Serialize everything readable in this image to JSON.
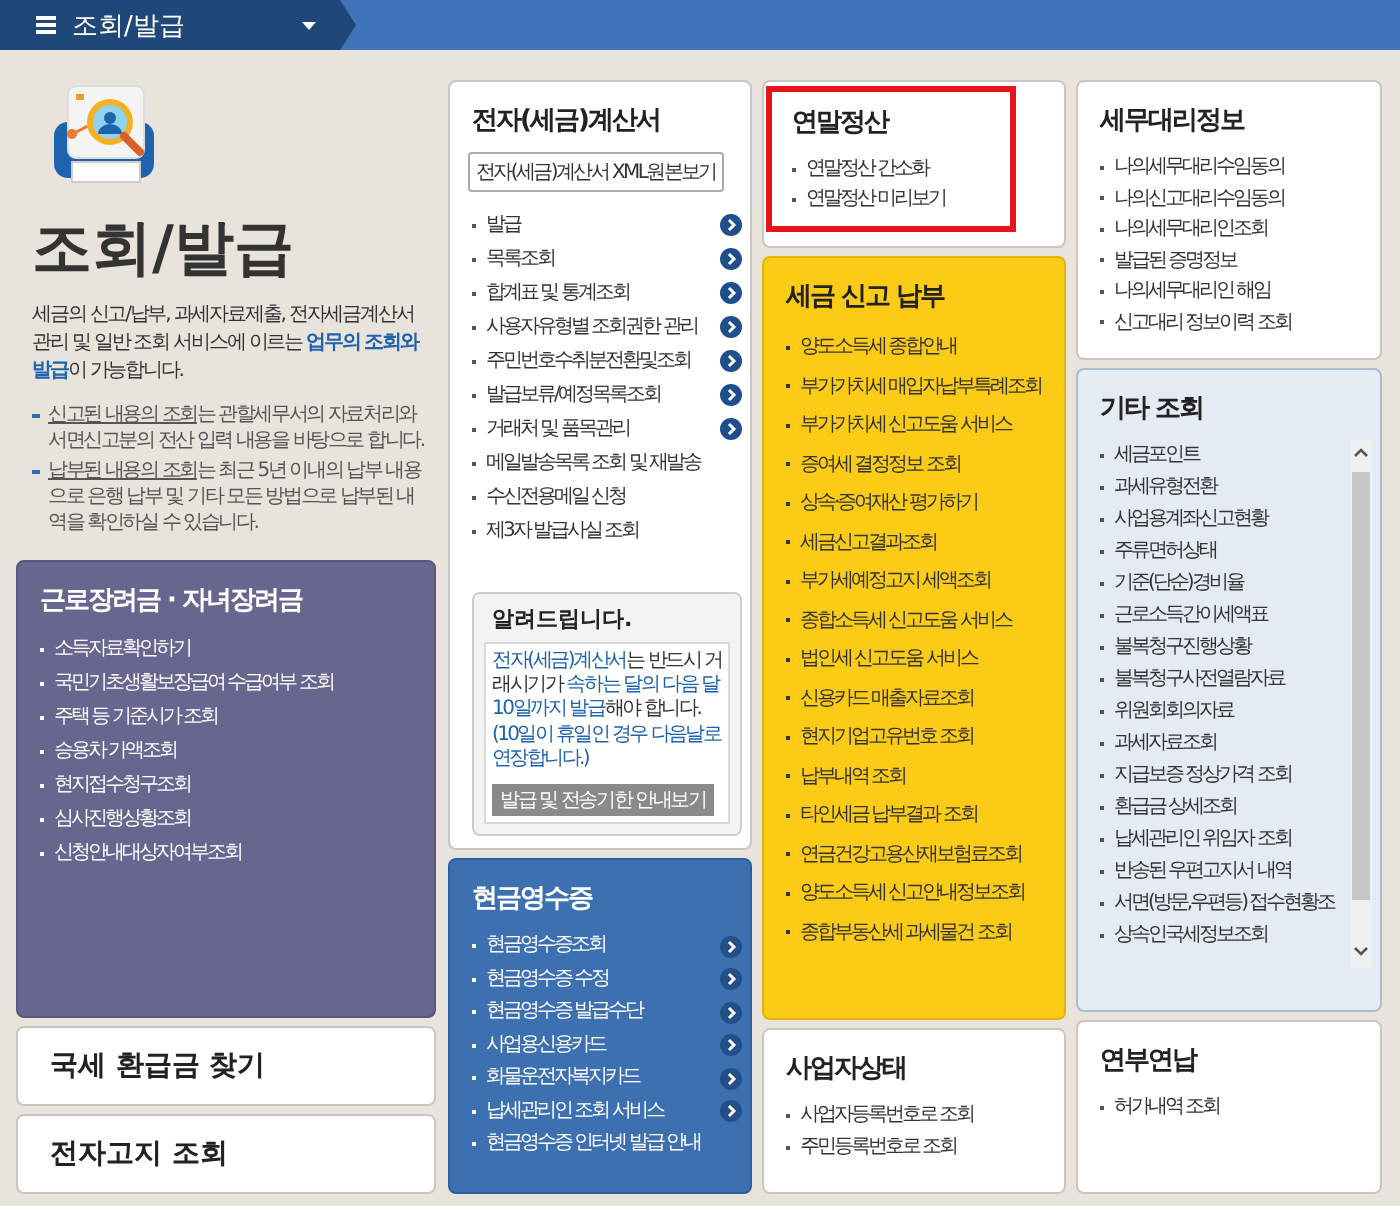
{
  "topbar": {
    "title": "조회/발급"
  },
  "intro": {
    "title": "조회/발급",
    "description": "세금의 신고/납부, 과세자료제출, 전자세금계산서 관리 및 일반 조회 서비스에 이르는 **업무의 조회와 발급**이 가능합니다.",
    "notes": [
      "**신고된 내용의 조회**는 관할세무서의 자료처리와 서면신고분의 전산 입력 내용을 바탕으로 합니다.",
      "**납부된 내용의 조회**는 최근 5년 이내의 납부 내용으로 은행 납부 및 기타 모든 방법으로 납부된 내역을 확인하실 수 있습니다."
    ]
  },
  "columns": [
    {
      "cards": [
        {
          "kind": "purple",
          "highlighted": false,
          "title": "근로장려금 · 자녀장려금",
          "items": [
            {
              "label": "소득자료확인하기",
              "arrow": false
            },
            {
              "label": "국민기초생활보장급여 수급여부 조회",
              "arrow": false
            },
            {
              "label": "주택 등 기준시가 조회",
              "arrow": false
            },
            {
              "label": "승용차 가액조회",
              "arrow": false
            },
            {
              "label": "현지접수청구조회",
              "arrow": false
            },
            {
              "label": "심사진행상황조회",
              "arrow": false
            },
            {
              "label": "신청안내대상자여부조회",
              "arrow": false
            }
          ]
        },
        {
          "kind": "link",
          "highlighted": false,
          "title": "국세 환급금 찾기"
        },
        {
          "kind": "link",
          "highlighted": false,
          "title": "전자고지 조회"
        }
      ]
    },
    {
      "cards": [
        {
          "kind": "white",
          "highlighted": false,
          "title": "전자(세금)계산서",
          "button": "전자(세금)계산서 XML원본보기",
          "items": [
            {
              "label": "발급",
              "arrow": true
            },
            {
              "label": "목록조회",
              "arrow": true
            },
            {
              "label": "합계표 및 통계조회",
              "arrow": true
            },
            {
              "label": "사용자유형별 조회권한 관리",
              "arrow": true
            },
            {
              "label": "주민번호수취분전환및조회",
              "arrow": true
            },
            {
              "label": "발급보류/예정목록조회",
              "arrow": true
            },
            {
              "label": "거래처 및 품목관리",
              "arrow": true
            },
            {
              "label": "메일발송목록 조회 및 재발송",
              "arrow": false
            },
            {
              "label": "수신전용메일 신청",
              "arrow": false
            },
            {
              "label": "제3자 발급사실 조회",
              "arrow": false
            }
          ],
          "notice": {
            "title": "알려드립니다.",
            "text": "**전자(세금)계산서**는 반드시 거래시기가 **속하는 달의 다음 달 10일까지 발급**해야 합니다.",
            "footnote": "(10일이 휴일인 경우 다음날로 연장합니다.)",
            "button": "발급 및 전송기한 안내보기"
          }
        },
        {
          "kind": "blue",
          "highlighted": false,
          "title": "현금영수증",
          "items": [
            {
              "label": "현금영수증조회",
              "arrow": true
            },
            {
              "label": "현금영수증 수정",
              "arrow": true
            },
            {
              "label": "현금영수증 발급수단",
              "arrow": true
            },
            {
              "label": "사업용신용카드",
              "arrow": true
            },
            {
              "label": "화물운전자복지카드",
              "arrow": true
            },
            {
              "label": "납세관리인 조회 서비스",
              "arrow": true
            },
            {
              "label": "현금영수증 인터넷 발급 안내",
              "arrow": false
            }
          ]
        }
      ]
    },
    {
      "cards": [
        {
          "kind": "white",
          "highlighted": true,
          "title": "연말정산",
          "items": [
            {
              "label": "연말정산 간소화",
              "arrow": false
            },
            {
              "label": "연말정산 미리보기",
              "arrow": false
            }
          ]
        },
        {
          "kind": "yellow",
          "highlighted": false,
          "title": "세금 신고 납부",
          "items": [
            {
              "label": "양도소득세 종합안내",
              "arrow": false
            },
            {
              "label": "부가가치세 매입자납부특례조회",
              "arrow": false
            },
            {
              "label": "부가가치세 신고도움 서비스",
              "arrow": false
            },
            {
              "label": "증여세 결정정보 조회",
              "arrow": false
            },
            {
              "label": "상속·증여재산 평가하기",
              "arrow": false
            },
            {
              "label": "세금신고결과조회",
              "arrow": false
            },
            {
              "label": "부가세예정고지 세액조회",
              "arrow": false
            },
            {
              "label": "종합소득세 신고도움 서비스",
              "arrow": false
            },
            {
              "label": "법인세 신고도움 서비스",
              "arrow": false
            },
            {
              "label": "신용카드 매출자료조회",
              "arrow": false
            },
            {
              "label": "현지기업고유번호 조회",
              "arrow": false
            },
            {
              "label": "납부내역 조회",
              "arrow": false
            },
            {
              "label": "타인세금 납부결과 조회",
              "arrow": false
            },
            {
              "label": "연금건강고용산재보험료조회",
              "arrow": false
            },
            {
              "label": "양도소득세 신고안내정보조회",
              "arrow": false
            },
            {
              "label": "종합부동산세 과세물건 조회",
              "arrow": false
            }
          ]
        },
        {
          "kind": "white",
          "highlighted": false,
          "title": "사업자상태",
          "items": [
            {
              "label": "사업자등록번호로 조회",
              "arrow": false
            },
            {
              "label": "주민등록번호로 조회",
              "arrow": false
            }
          ]
        }
      ]
    },
    {
      "cards": [
        {
          "kind": "white",
          "highlighted": false,
          "title": "세무대리정보",
          "items": [
            {
              "label": "나의세무대리수임동의",
              "arrow": false
            },
            {
              "label": "나의신고대리수임동의",
              "arrow": false
            },
            {
              "label": "나의세무대리인조회",
              "arrow": false
            },
            {
              "label": "발급된 증명정보",
              "arrow": false
            },
            {
              "label": "나의세무대리인 해임",
              "arrow": false
            },
            {
              "label": "신고대리 정보이력 조회",
              "arrow": false
            }
          ]
        },
        {
          "kind": "pale",
          "highlighted": false,
          "scrollable": true,
          "title": "기타 조회",
          "items": [
            {
              "label": "세금포인트",
              "arrow": false
            },
            {
              "label": "과세유형전환",
              "arrow": false
            },
            {
              "label": "사업용계좌신고현황",
              "arrow": false
            },
            {
              "label": "주류면허상태",
              "arrow": false
            },
            {
              "label": "기준(단순)경비율",
              "arrow": false
            },
            {
              "label": "근로소득간이세액표",
              "arrow": false
            },
            {
              "label": "불복청구진행상황",
              "arrow": false
            },
            {
              "label": "불복청구사전열람자료",
              "arrow": false
            },
            {
              "label": "위원회회의자료",
              "arrow": false
            },
            {
              "label": "과세자료조회",
              "arrow": false
            },
            {
              "label": "지급보증 정상가격 조회",
              "arrow": false
            },
            {
              "label": "환급금 상세조회",
              "arrow": false
            },
            {
              "label": "납세관리인 위임자 조회",
              "arrow": false
            },
            {
              "label": "반송된 우편고지서 내역",
              "arrow": false
            },
            {
              "label": "서면(방문,우편등) 접수현황조",
              "arrow": false
            },
            {
              "label": "상속인국세정보조회",
              "arrow": false
            }
          ]
        },
        {
          "kind": "white",
          "highlighted": false,
          "title": "연부연납",
          "items": [
            {
              "label": "허가내역 조회",
              "arrow": false
            }
          ]
        }
      ]
    }
  ]
}
